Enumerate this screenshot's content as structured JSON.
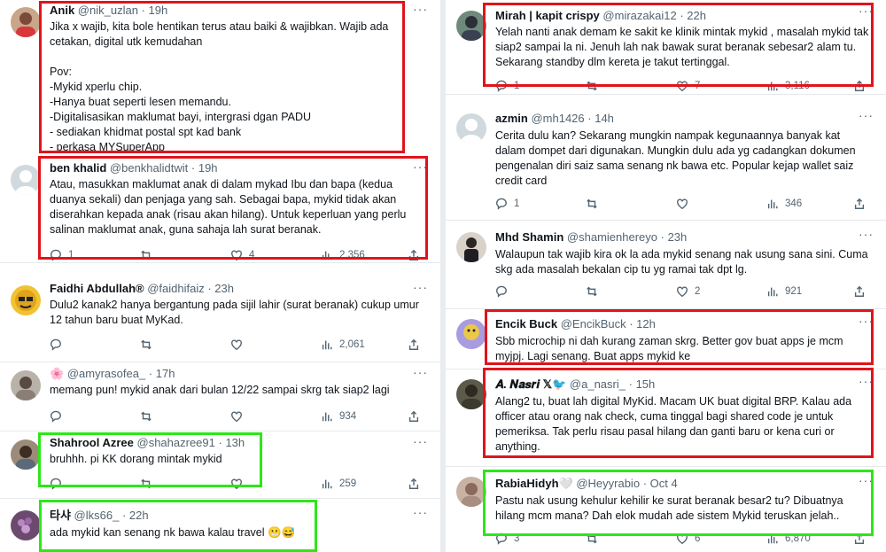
{
  "more_glyph": "···",
  "left_posts": [
    {
      "name": "Anik",
      "handle": "@nik_uzlan",
      "time": "· 19h",
      "body": "Jika x wajib, kita bole hentikan terus atau baiki & wajibkan. Wajib ada cetakan, digital utk kemudahan\n\nPov:\n-Mykid xperlu chip.\n-Hanya buat seperti lesen memandu.\n-Digitalisasikan maklumat bayi, intergrasi dgan PADU\n- sediakan khidmat postal spt kad bank\n- perkasa MYSuperApp"
    },
    {
      "name": "ben khalid",
      "handle": "@benkhalidtwit",
      "time": "· 19h",
      "body": "Atau, masukkan maklumat anak di dalam mykad Ibu dan bapa (kedua duanya sekali) dan penjaga yang sah. Sebagai bapa, mykid tidak akan diserahkan kepada anak (risau akan hilang). Untuk keperluan yang perlu salinan maklumat anak, guna sahaja lah surat beranak.",
      "reply": "1",
      "retweet": "",
      "like": "4",
      "views": "2,356"
    },
    {
      "name": "Faidhi Abdullah®",
      "handle": "@faidhifaiz",
      "time": "· 23h",
      "body": "Dulu2 kanak2 hanya bergantung pada sijil lahir (surat beranak) cukup umur 12 tahun baru buat MyKad.",
      "reply": "",
      "retweet": "",
      "like": "",
      "views": "2,061"
    },
    {
      "name": "🌸",
      "handle": "@amyrasofea_",
      "time": "· 17h",
      "body": "memang pun! mykid anak dari bulan 12/22 sampai skrg tak siap2 lagi",
      "reply": "",
      "retweet": "",
      "like": "",
      "views": "934"
    },
    {
      "name": "Shahrool Azree",
      "handle": "@shahazree91",
      "time": "· 13h",
      "body": "bruhhh. pi KK dorang mintak mykid",
      "reply": "",
      "retweet": "",
      "like": "",
      "views": "259"
    },
    {
      "name": "타샤",
      "handle": "@lks66_",
      "time": "· 22h",
      "body": "ada mykid kan senang nk bawa kalau travel 😬😅"
    }
  ],
  "right_posts": [
    {
      "name": "Mirah | kapit crispy",
      "handle": "@mirazakai12",
      "time": "· 22h",
      "body": "Yelah nanti anak demam ke sakit ke klinik mintak mykid , masalah mykid tak siap2 sampai la ni. Jenuh lah nak bawak surat beranak sebesar2 alam tu. Sekarang standby dlm kereta je takut tertinggal.",
      "reply": "1",
      "retweet": "",
      "like": "7",
      "views": "3,116"
    },
    {
      "name": "azmin",
      "handle": "@mh1426",
      "time": "· 14h",
      "body": "Cerita dulu kan? Sekarang mungkin nampak kegunaannya banyak kat dalam dompet dari digunakan. Mungkin dulu ada yg cadangkan dokumen pengenalan diri saiz sama senang nk bawa etc. Popular kejap wallet saiz credit card",
      "reply": "1",
      "retweet": "",
      "like": "",
      "views": "346"
    },
    {
      "name": "Mhd Shamin",
      "handle": "@shamienhereyo",
      "time": "· 23h",
      "body": "Walaupun tak wajib kira ok la ada mykid senang nak usung sana sini. Cuma skg ada masalah bekalan cip tu yg ramai tak dpt lg.",
      "reply": "",
      "retweet": "",
      "like": "2",
      "views": "921"
    },
    {
      "name": "Encik Buck",
      "handle": "@EncikBuck",
      "time": "· 12h",
      "body": "Sbb microchip ni dah kurang zaman skrg. Better gov buat apps je mcm myjpj. Lagi senang. Buat apps mykid ke"
    },
    {
      "name": "𝑨. 𝑵𝒂𝒔𝒓𝒊 𝕏🐦",
      "handle": "@a_nasri_",
      "time": "· 15h",
      "body": "Alang2 tu, buat lah digital MyKid. Macam UK buat digital BRP. Kalau ada officer atau orang nak check, cuma tinggal bagi shared code je untuk pemeriksa. Tak perlu risau pasal hilang dan ganti baru or kena curi or anything."
    },
    {
      "name": "RabiaHidyh🤍",
      "handle": "@Heyyrabio",
      "time": "· Oct 4",
      "body": "Pastu nak usung kehulur kehilir ke surat beranak besar2 tu? Dibuatnya hilang mcm mana? Dah elok mudah ade sistem Mykid teruskan jelah..",
      "reply": "3",
      "retweet": "",
      "like": "6",
      "views": "6,870"
    }
  ]
}
